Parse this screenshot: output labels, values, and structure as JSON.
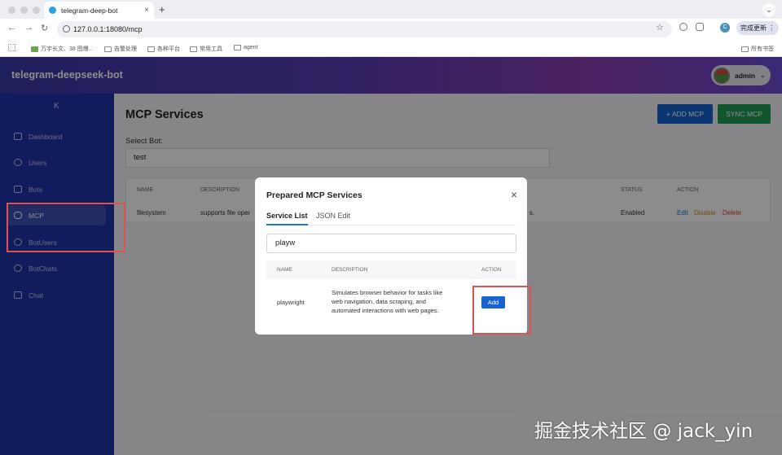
{
  "browser": {
    "tab_title": "telegram-deep-bot",
    "tab_close": "×",
    "new_tab": "+",
    "url": "127.0.0.1:18080/mcp",
    "update_button": "完成更新",
    "profile_initial": "C",
    "bookmarks": [
      "万宇长文、38 图爆...",
      "告警处理",
      "各种平台",
      "常用工具",
      "agent"
    ],
    "all_bookmarks": "所有书签"
  },
  "app": {
    "title": "telegram-deepseek-bot",
    "user": "admin"
  },
  "sidebar": {
    "collapse": "K",
    "items": [
      {
        "label": "Dashboard",
        "icon": "dashboard-icon"
      },
      {
        "label": "Users",
        "icon": "users-icon"
      },
      {
        "label": "Bots",
        "icon": "robot-icon"
      },
      {
        "label": "MCP",
        "icon": "database-icon"
      },
      {
        "label": "BotUsers",
        "icon": "user-circle-icon"
      },
      {
        "label": "BotChats",
        "icon": "chat-bubble-icon"
      },
      {
        "label": "Chat",
        "icon": "message-icon"
      }
    ]
  },
  "main": {
    "title": "MCP Services",
    "add_button": "+ ADD MCP",
    "sync_button": "SYNC MCP",
    "select_label": "Select Bot:",
    "select_value": "test",
    "table": {
      "headers": [
        "NAME",
        "DESCRIPTION",
        "STATUS",
        "ACTION"
      ],
      "rows": [
        {
          "name": "filesystem",
          "description": "supports file oper",
          "desc_tail": "s.",
          "status": "Enabled",
          "actions": [
            "Edit",
            "Disable",
            "Delete"
          ]
        }
      ]
    }
  },
  "modal": {
    "title": "Prepared MCP Services",
    "close": "×",
    "tabs": [
      "Service List",
      "JSON Edit"
    ],
    "search_value": "playw",
    "headers": [
      "NAME",
      "DESCRIPTION",
      "ACTION"
    ],
    "rows": [
      {
        "name": "playwright",
        "description_lines": [
          "Simulates browser behavior for tasks like",
          "web navigation, data scraping, and",
          "automated interactions with web pages."
        ],
        "action": "Add"
      }
    ]
  },
  "watermark": "掘金技术社区 @ jack_yin"
}
